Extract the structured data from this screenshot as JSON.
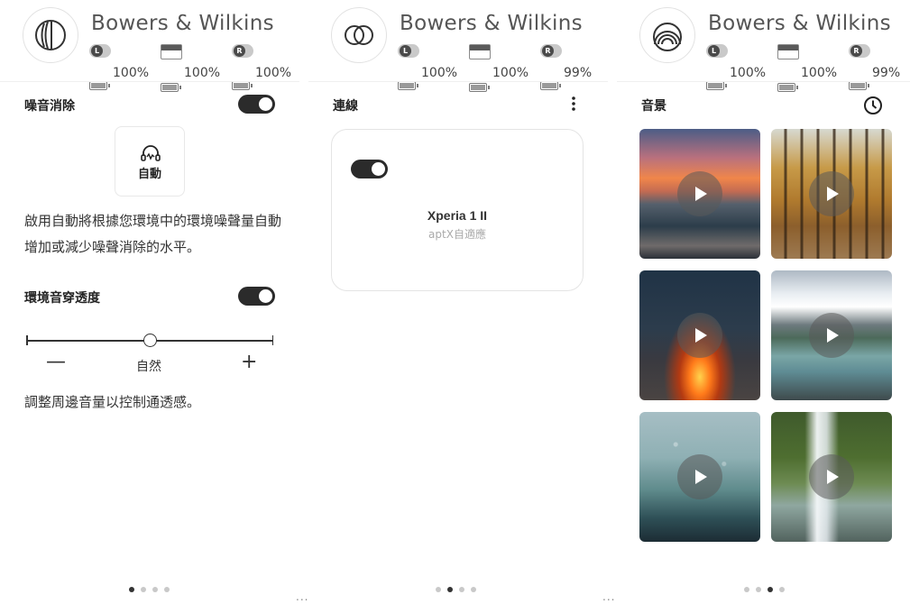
{
  "panels": [
    {
      "brand": "Bowers & Wilkins",
      "logo_icon": "double-arc-logo-icon",
      "battery": {
        "left": "100%",
        "case": "100%",
        "right": "100%"
      },
      "title": "噪音消除",
      "anc_mode_label": "自動",
      "anc_description": "啟用自動將根據您環境中的環境噪聲量自動增加或減少噪聲消除的水平。",
      "transparency_title": "環境音穿透度",
      "slider_minus": "—",
      "slider_label": "自然",
      "slider_plus": "+",
      "transparency_level": 0.5,
      "transparency_description": "調整周邊音量以控制通透感。",
      "page_dots_active": 0
    },
    {
      "brand": "Bowers & Wilkins",
      "logo_icon": "overlapping-circles-logo-icon",
      "battery": {
        "left": "100%",
        "case": "100%",
        "right": "99%"
      },
      "title": "連線",
      "device_name": "Xperia 1 II",
      "codec": "aptX自適應",
      "page_dots_active": 1
    },
    {
      "brand": "Bowers & Wilkins",
      "logo_icon": "concentric-arcs-logo-icon",
      "battery": {
        "left": "100%",
        "case": "100%",
        "right": "99%"
      },
      "title": "音景",
      "soundscapes": [
        "sunset-beach",
        "autumn-forest",
        "campfire",
        "mountain-river",
        "rain-window",
        "waterfall"
      ],
      "page_dots_active": 2
    }
  ],
  "separator_1": "...",
  "separator_2": "..."
}
